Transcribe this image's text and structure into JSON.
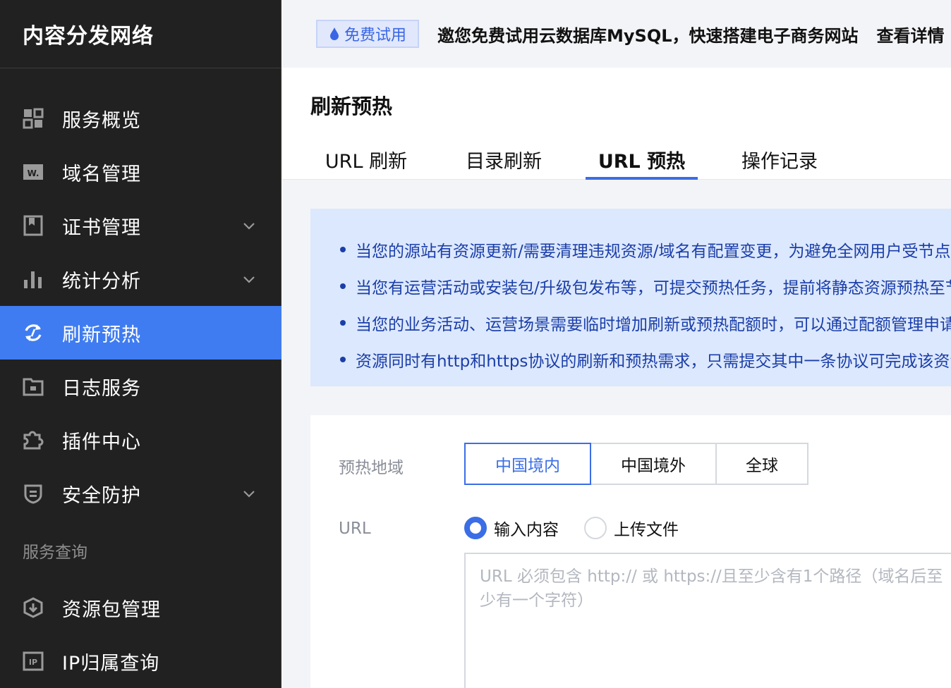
{
  "sidebar": {
    "app_title": "内容分发网络",
    "items": [
      {
        "label": "服务概览",
        "icon": "dashboard-icon",
        "expandable": false,
        "active": false
      },
      {
        "label": "域名管理",
        "icon": "domain-icon",
        "expandable": false,
        "active": false
      },
      {
        "label": "证书管理",
        "icon": "certificate-icon",
        "expandable": true,
        "active": false
      },
      {
        "label": "统计分析",
        "icon": "bar-chart-icon",
        "expandable": true,
        "active": false
      },
      {
        "label": "刷新预热",
        "icon": "refresh-icon",
        "expandable": false,
        "active": true
      },
      {
        "label": "日志服务",
        "icon": "folder-icon",
        "expandable": false,
        "active": false
      },
      {
        "label": "插件中心",
        "icon": "puzzle-icon",
        "expandable": false,
        "active": false
      },
      {
        "label": "安全防护",
        "icon": "shield-icon",
        "expandable": true,
        "active": false
      }
    ],
    "group_label": "服务查询",
    "group_items": [
      {
        "label": "资源包管理",
        "icon": "package-icon"
      },
      {
        "label": "IP归属查询",
        "icon": "ip-icon"
      }
    ]
  },
  "promo": {
    "badge": "免费试用",
    "text": "邀您免费试用云数据库MySQL，快速搭建电子商务网站",
    "link": "查看详情"
  },
  "page": {
    "title": "刷新预热",
    "tabs": [
      {
        "label": "URL 刷新",
        "active": false
      },
      {
        "label": "目录刷新",
        "active": false
      },
      {
        "label": "URL 预热",
        "active": true
      },
      {
        "label": "操作记录",
        "active": false
      }
    ]
  },
  "info": {
    "items": [
      "当您的源站有资源更新/需要清理违规资源/域名有配置变更，为避免全网用户受节点缓存影响",
      "当您有运营活动或安装包/升级包发布等，可提交预热任务，提前将静态资源预热至节点",
      "当您的业务活动、运营场景需要临时增加刷新或预热配额时，可以通过配额管理申请",
      "资源同时有http和https协议的刷新和预热需求，只需提交其中一条协议可完成该资源的刷新和预热"
    ]
  },
  "form": {
    "region_label": "预热地域",
    "regions": [
      {
        "label": "中国境内",
        "active": true
      },
      {
        "label": "中国境外",
        "active": false
      },
      {
        "label": "全球",
        "active": false
      }
    ],
    "url_label": "URL",
    "input_modes": [
      {
        "label": "输入内容",
        "checked": true
      },
      {
        "label": "上传文件",
        "checked": false
      }
    ],
    "url_placeholder": "URL 必须包含 http:// 或 https://且至少含有1个路径（域名后至少有一个字符）",
    "url_value": ""
  },
  "colors": {
    "sidebar_bg": "#212121",
    "active_nav": "#3f7cf1",
    "accent": "#3b6ee6",
    "info_bg": "#dce8fd",
    "info_text": "#1b3ea8"
  }
}
